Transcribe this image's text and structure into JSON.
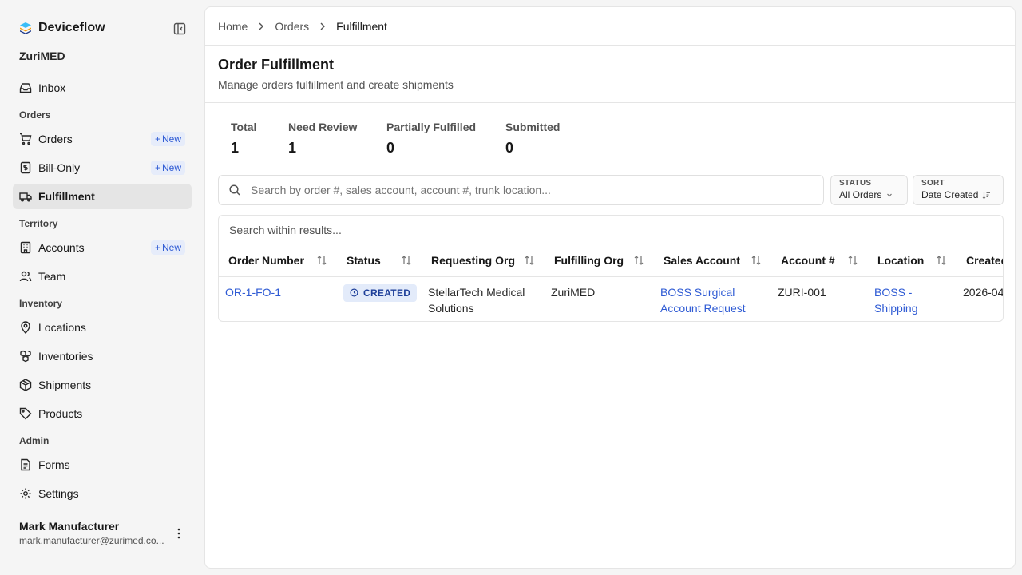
{
  "app": {
    "name": "Deviceflow",
    "org": "ZuriMED"
  },
  "sidebar": {
    "items": [
      {
        "type": "item",
        "label": "Inbox",
        "icon": "inbox-icon"
      },
      {
        "type": "section",
        "label": "Orders"
      },
      {
        "type": "item",
        "label": "Orders",
        "icon": "cart-icon",
        "badge": "New"
      },
      {
        "type": "item",
        "label": "Bill-Only",
        "icon": "invoice-icon",
        "badge": "New"
      },
      {
        "type": "item",
        "label": "Fulfillment",
        "icon": "truck-icon",
        "active": true
      },
      {
        "type": "section",
        "label": "Territory"
      },
      {
        "type": "item",
        "label": "Accounts",
        "icon": "building-icon",
        "badge": "New"
      },
      {
        "type": "item",
        "label": "Team",
        "icon": "users-icon"
      },
      {
        "type": "section",
        "label": "Inventory"
      },
      {
        "type": "item",
        "label": "Locations",
        "icon": "map-pin-icon"
      },
      {
        "type": "item",
        "label": "Inventories",
        "icon": "boxes-icon"
      },
      {
        "type": "item",
        "label": "Shipments",
        "icon": "package-icon"
      },
      {
        "type": "item",
        "label": "Products",
        "icon": "tag-icon"
      },
      {
        "type": "section",
        "label": "Admin"
      },
      {
        "type": "item",
        "label": "Forms",
        "icon": "file-text-icon"
      },
      {
        "type": "item",
        "label": "Settings",
        "icon": "gear-icon"
      }
    ],
    "user": {
      "name": "Mark Manufacturer",
      "email": "mark.manufacturer@zurimed.co..."
    }
  },
  "breadcrumb": {
    "home": "Home",
    "orders": "Orders",
    "current": "Fulfillment"
  },
  "header": {
    "title": "Order Fulfillment",
    "subtitle": "Manage orders fulfillment and create shipments"
  },
  "stats": [
    {
      "label": "Total",
      "value": "1"
    },
    {
      "label": "Need Review",
      "value": "1"
    },
    {
      "label": "Partially Fulfilled",
      "value": "0"
    },
    {
      "label": "Submitted",
      "value": "0"
    }
  ],
  "search": {
    "placeholder": "Search by order #, sales account, account #, trunk location..."
  },
  "filters": {
    "status": {
      "key": "STATUS",
      "value": "All Orders"
    },
    "sort": {
      "key": "SORT",
      "value": "Date Created"
    }
  },
  "table": {
    "within_placeholder": "Search within results...",
    "columns": [
      "Order Number",
      "Status",
      "Requesting Org",
      "Fulfilling Org",
      "Sales Account",
      "Account #",
      "Location",
      "Created"
    ],
    "rows": [
      {
        "order_number": "OR-1-FO-1",
        "status": "CREATED",
        "requesting_org": "StellarTech Medical Solutions",
        "fulfilling_org": "ZuriMED",
        "sales_account": "BOSS Surgical Account Request",
        "account_number": "ZURI-001",
        "location": "BOSS - Shipping",
        "created": "2026-04"
      }
    ]
  },
  "colors": {
    "accent": "#2f5bd4",
    "status_bg": "#e3ebfa",
    "status_text": "#1e3f99"
  }
}
